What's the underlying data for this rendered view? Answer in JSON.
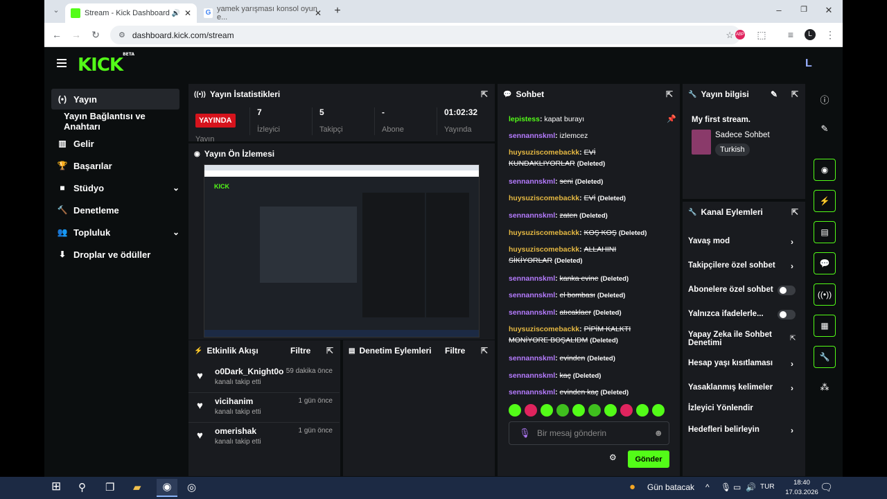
{
  "browser": {
    "tabs": [
      {
        "label": "Stream - Kick Dashboard",
        "active": true
      },
      {
        "label": "yamek yarışması konsol oyun e...",
        "active": false
      }
    ],
    "url": "dashboard.kick.com/stream",
    "profile_initial": "L"
  },
  "app": {
    "logo": "KICK",
    "logo_badge": "BETA",
    "user_initial": "L"
  },
  "nav": [
    {
      "label": "Yayın",
      "icon": "(•)"
    },
    {
      "label": "Yayın Bağlantısı ve Anahtarı",
      "icon": ""
    },
    {
      "label": "Gelir",
      "icon": "▥"
    },
    {
      "label": "Başarılar",
      "icon": "🏆"
    },
    {
      "label": "Stüdyo",
      "icon": "■"
    },
    {
      "label": "Denetleme",
      "icon": "🔨"
    },
    {
      "label": "Topluluk",
      "icon": "👥"
    },
    {
      "label": "Droplar ve ödüller",
      "icon": "⬇"
    }
  ],
  "stats": {
    "title": "Yayın İstatistikleri",
    "live_badge": "YAYINDA",
    "live_label": "Yayın",
    "viewers": "7",
    "viewers_label": "İzleyici",
    "followers": "5",
    "followers_label": "Takipçi",
    "subs": "-",
    "subs_label": "Abone",
    "duration": "01:02:32",
    "duration_label": "Yayında"
  },
  "preview": {
    "title": "Yayın Ön İzlemesi"
  },
  "activity": {
    "title": "Etkinlik Akışı",
    "filter": "Filtre",
    "items": [
      {
        "name": "o0Dark_Knight0o",
        "time": "59 dakika önce",
        "action": "kanalı takip etti"
      },
      {
        "name": "vicihanim",
        "time": "1 gün önce",
        "action": "kanalı takip etti"
      },
      {
        "name": "omerishak",
        "time": "1 gün önce",
        "action": "kanalı takip etti"
      }
    ]
  },
  "moderation": {
    "title": "Denetim Eylemleri",
    "filter": "Filtre"
  },
  "chat": {
    "title": "Sohbet",
    "messages": [
      {
        "user": "lepistess",
        "color": "#53fc18",
        "text": "kapat burayı",
        "deleted": false
      },
      {
        "user": "sennannskml",
        "color": "#b57bff",
        "text": "izlemcez",
        "deleted": false
      },
      {
        "user": "huysuziscomebackk",
        "color": "#e5b842",
        "text": "EVİ KUNDAKLIYORLAR",
        "deleted": true
      },
      {
        "user": "sennannskml",
        "color": "#b57bff",
        "text": "seni",
        "deleted": true
      },
      {
        "user": "huysuziscomebackk",
        "color": "#e5b842",
        "text": "EVİ",
        "deleted": true
      },
      {
        "user": "sennannskml",
        "color": "#b57bff",
        "text": "zaten",
        "deleted": true
      },
      {
        "user": "huysuziscomebackk",
        "color": "#e5b842",
        "text": "KOŞ KOŞ",
        "deleted": true
      },
      {
        "user": "huysuziscomebackk",
        "color": "#e5b842",
        "text": "ALLAHINI SİKİYORLAR",
        "deleted": true
      },
      {
        "user": "sennannskml",
        "color": "#b57bff",
        "text": "kanka evine",
        "deleted": true
      },
      {
        "user": "sennannskml",
        "color": "#b57bff",
        "text": "el bombası",
        "deleted": true
      },
      {
        "user": "sennannskml",
        "color": "#b57bff",
        "text": "atıcaklaer",
        "deleted": true
      },
      {
        "user": "huysuziscomebackk",
        "color": "#e5b842",
        "text": "PİPİM KALKTI MONİYORE BOŞALIDM",
        "deleted": true
      },
      {
        "user": "sennannskml",
        "color": "#b57bff",
        "text": "evinden",
        "deleted": true
      },
      {
        "user": "sennannskml",
        "color": "#b57bff",
        "text": "kaç",
        "deleted": true
      },
      {
        "user": "sennannskml",
        "color": "#b57bff",
        "text": "evinden kaç",
        "deleted": true
      }
    ],
    "deleted_label": "(Deleted)",
    "input_placeholder": "Bir mesaj gönderin",
    "send_label": "Gönder"
  },
  "stream_info": {
    "title": "Yayın bilgisi",
    "stream_title": "My first stream.",
    "category": "Sadece Sohbet",
    "language": "Turkish"
  },
  "channel_actions": {
    "title": "Kanal Eylemleri",
    "items": [
      {
        "label": "Yavaş mod",
        "kind": "arrow"
      },
      {
        "label": "Takipçilere özel sohbet",
        "kind": "arrow"
      },
      {
        "label": "Abonelere özel sohbet",
        "kind": "toggle"
      },
      {
        "label": "Yalnızca ifadelerle...",
        "kind": "toggle"
      },
      {
        "label": "Yapay Zeka ile Sohbet Denetimi",
        "kind": "external"
      },
      {
        "label": "Hesap yaşı kısıtlaması",
        "kind": "arrow"
      },
      {
        "label": "Yasaklanmış kelimeler",
        "kind": "arrow"
      },
      {
        "label": "İzleyici Yönlendir",
        "kind": "none"
      },
      {
        "label": "Hedefleri belirleyin",
        "kind": "arrow"
      }
    ]
  },
  "taskbar": {
    "weather": "Gün batacak",
    "lang": "TUR",
    "time": "18:40",
    "date": "17.03.2026"
  },
  "colors": {
    "accent": "#53fc18",
    "live": "#d6131c",
    "panel": "#191b1f"
  }
}
